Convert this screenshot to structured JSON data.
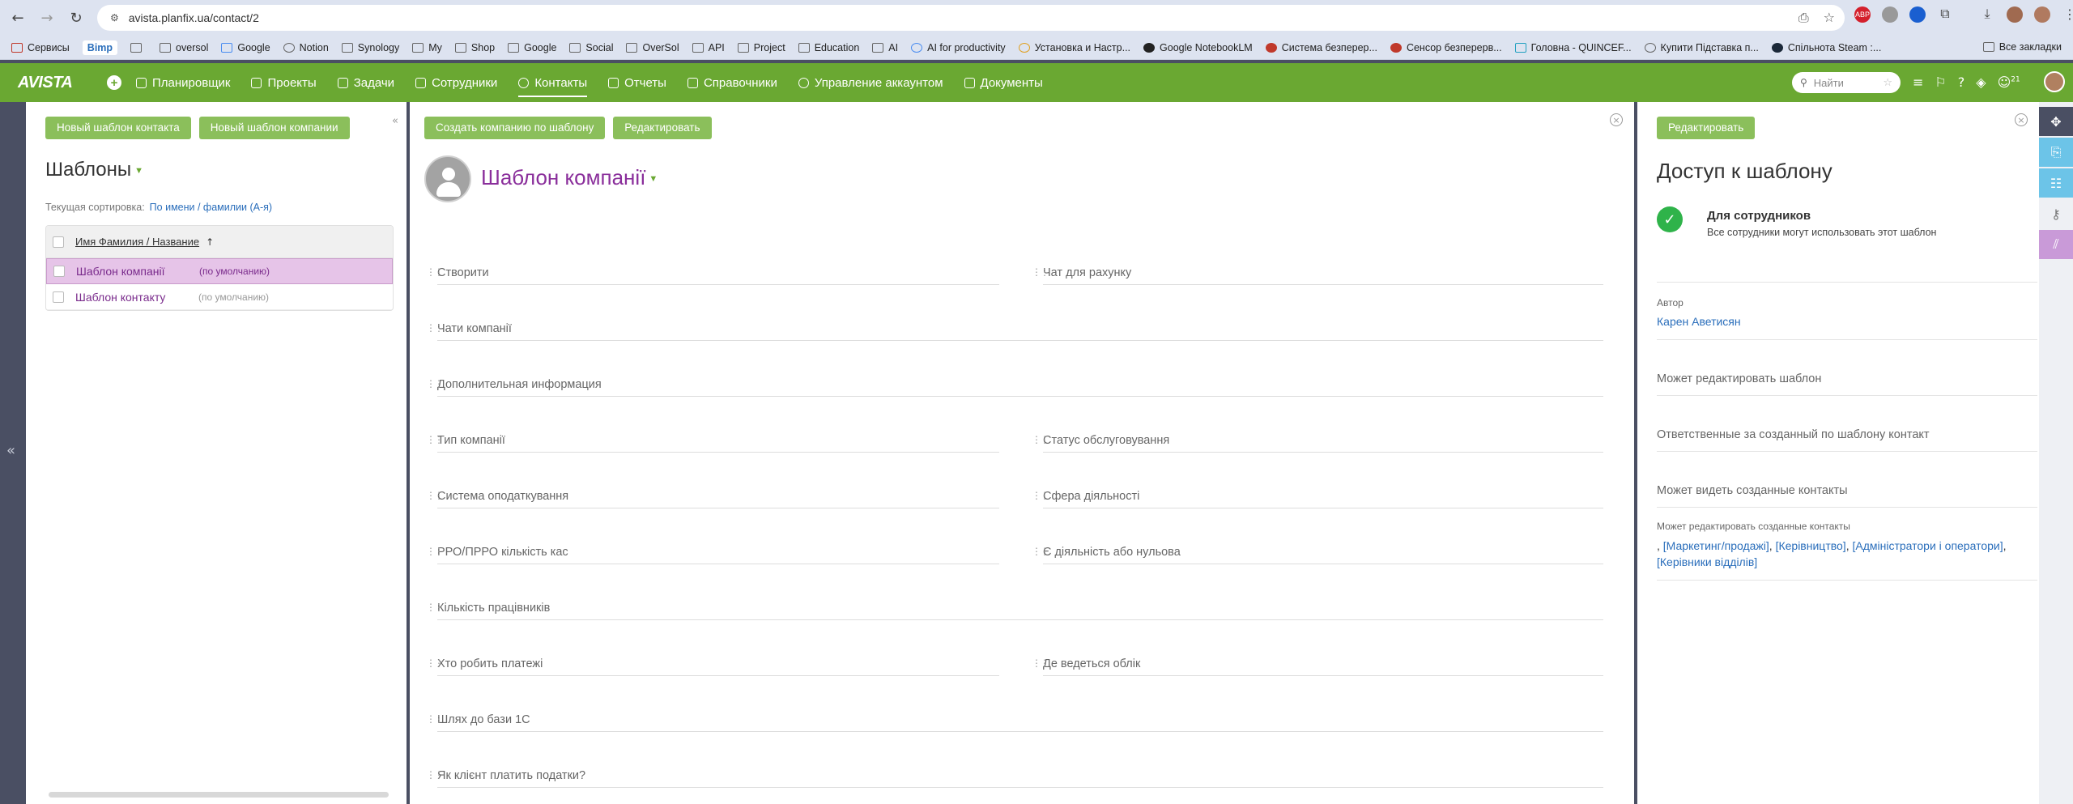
{
  "browser": {
    "url": "avista.planfix.ua/contact/2",
    "bookmarks": [
      {
        "label": "Сервисы"
      },
      {
        "label": "Bimp"
      },
      {
        "label": ""
      },
      {
        "label": "oversol"
      },
      {
        "label": "Google"
      },
      {
        "label": "Notion"
      },
      {
        "label": "Synology"
      },
      {
        "label": "My"
      },
      {
        "label": "Shop"
      },
      {
        "label": "Google"
      },
      {
        "label": "Social"
      },
      {
        "label": "OverSol"
      },
      {
        "label": "API"
      },
      {
        "label": "Project"
      },
      {
        "label": "Education"
      },
      {
        "label": "AI"
      },
      {
        "label": "AI for productivity"
      },
      {
        "label": "Установка и Настр..."
      },
      {
        "label": "Google NotebookLM"
      },
      {
        "label": "Система безперер..."
      },
      {
        "label": "Сенсор безперерв..."
      },
      {
        "label": "Головна - QUINCEF..."
      },
      {
        "label": "Купити Підставка п..."
      },
      {
        "label": "Спільнота Steam :..."
      }
    ],
    "all_bookmarks": "Все закладки"
  },
  "app": {
    "logo": "AVISTA",
    "menu": [
      {
        "label": "Планировщик"
      },
      {
        "label": "Проекты"
      },
      {
        "label": "Задачи"
      },
      {
        "label": "Сотрудники"
      },
      {
        "label": "Контакты"
      },
      {
        "label": "Отчеты"
      },
      {
        "label": "Справочники"
      },
      {
        "label": "Управление аккаунтом"
      },
      {
        "label": "Документы"
      }
    ],
    "search_placeholder": "Найти",
    "notif_count": "21"
  },
  "left": {
    "buttons": {
      "new_contact": "Новый шаблон контакта",
      "new_company": "Новый шаблон компании"
    },
    "title": "Шаблоны",
    "sort_label": "Текущая сортировка:",
    "sort_value": "По имени / фамилии (А-я)",
    "column": "Имя Фамилия / Название",
    "rows": [
      {
        "name": "Шаблон компанії",
        "default": "(по умолчанию)"
      },
      {
        "name": "Шаблон контакту",
        "default": "(по умолчанию)"
      }
    ]
  },
  "mid": {
    "buttons": {
      "create": "Создать компанию по шаблону",
      "edit": "Редактировать"
    },
    "title": "Шаблон компанії",
    "fields": {
      "f1": "Створити",
      "f2": "Чат для рахунку",
      "f3": "Чати компанії",
      "f4": "Дополнительная информация",
      "f5": "Тип компанії",
      "f6": "Статус обслуговування",
      "f7": "Система оподаткування",
      "f8": "Сфера діяльності",
      "f9": "РРО/ПРРО кількість кас",
      "f10": "Є діяльність або нульова",
      "f11": "Кількість працівників",
      "f12": "Хто робить платежі",
      "f13": "Де ведеться облік",
      "f14": "Шлях до бази 1С",
      "f15": "Як клієнт платить податки?"
    }
  },
  "right": {
    "edit_button": "Редактировать",
    "title": "Доступ к шаблону",
    "access_label": "Для сотрудников",
    "access_desc": "Все сотрудники могут использовать этот шаблон",
    "author_label": "Автор",
    "author_name": "Карен Аветисян",
    "can_edit_template": "Может редактировать шаблон",
    "responsible": "Ответственные за созданный по шаблону контакт",
    "can_view": "Может видеть созданные контакты",
    "can_edit_contacts": "Может редактировать созданные контакты",
    "groups": {
      "g1": "[Маркетинг/продажі]",
      "g2": "[Керівництво]",
      "g3": "[Адміністратори і оператори]",
      "g4": "[Керівники відділів]"
    }
  }
}
